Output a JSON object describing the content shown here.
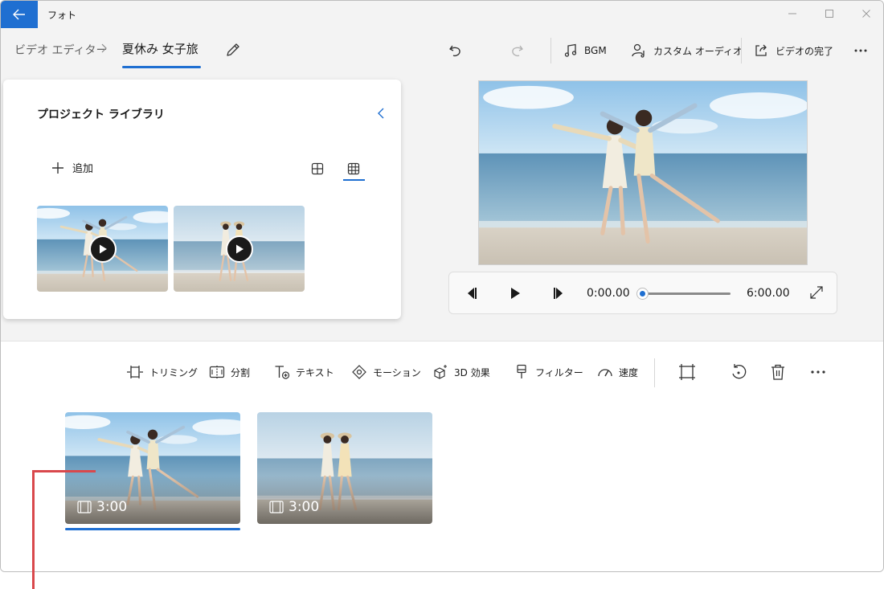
{
  "app": {
    "title": "フォト"
  },
  "breadcrumb": {
    "root": "ビデオ エディター",
    "current": "夏休み 女子旅"
  },
  "toolbar": {
    "bgm_label": "BGM",
    "custom_audio_label": "カスタム オーディオ",
    "finish_video_label": "ビデオの完了"
  },
  "library": {
    "title": "プロジェクト ライブラリ",
    "add_label": "追加",
    "items": [
      {
        "type": "video",
        "scene": "beach-jump"
      },
      {
        "type": "video",
        "scene": "beach-walk"
      }
    ]
  },
  "player": {
    "current_time": "0:00.00",
    "total_time": "6:00.00",
    "progress": 0
  },
  "storyboard": {
    "tools": {
      "trim": "トリミング",
      "split": "分割",
      "text": "テキスト",
      "motion": "モーション",
      "effects3d": "3D 効果",
      "filter": "フィルター",
      "speed": "速度"
    },
    "clips": [
      {
        "duration": "3:00",
        "selected": true,
        "scene": "beach-jump"
      },
      {
        "duration": "3:00",
        "selected": false,
        "scene": "beach-walk"
      }
    ]
  },
  "colors": {
    "accent": "#1f6fd1",
    "callout": "#d9484c"
  }
}
